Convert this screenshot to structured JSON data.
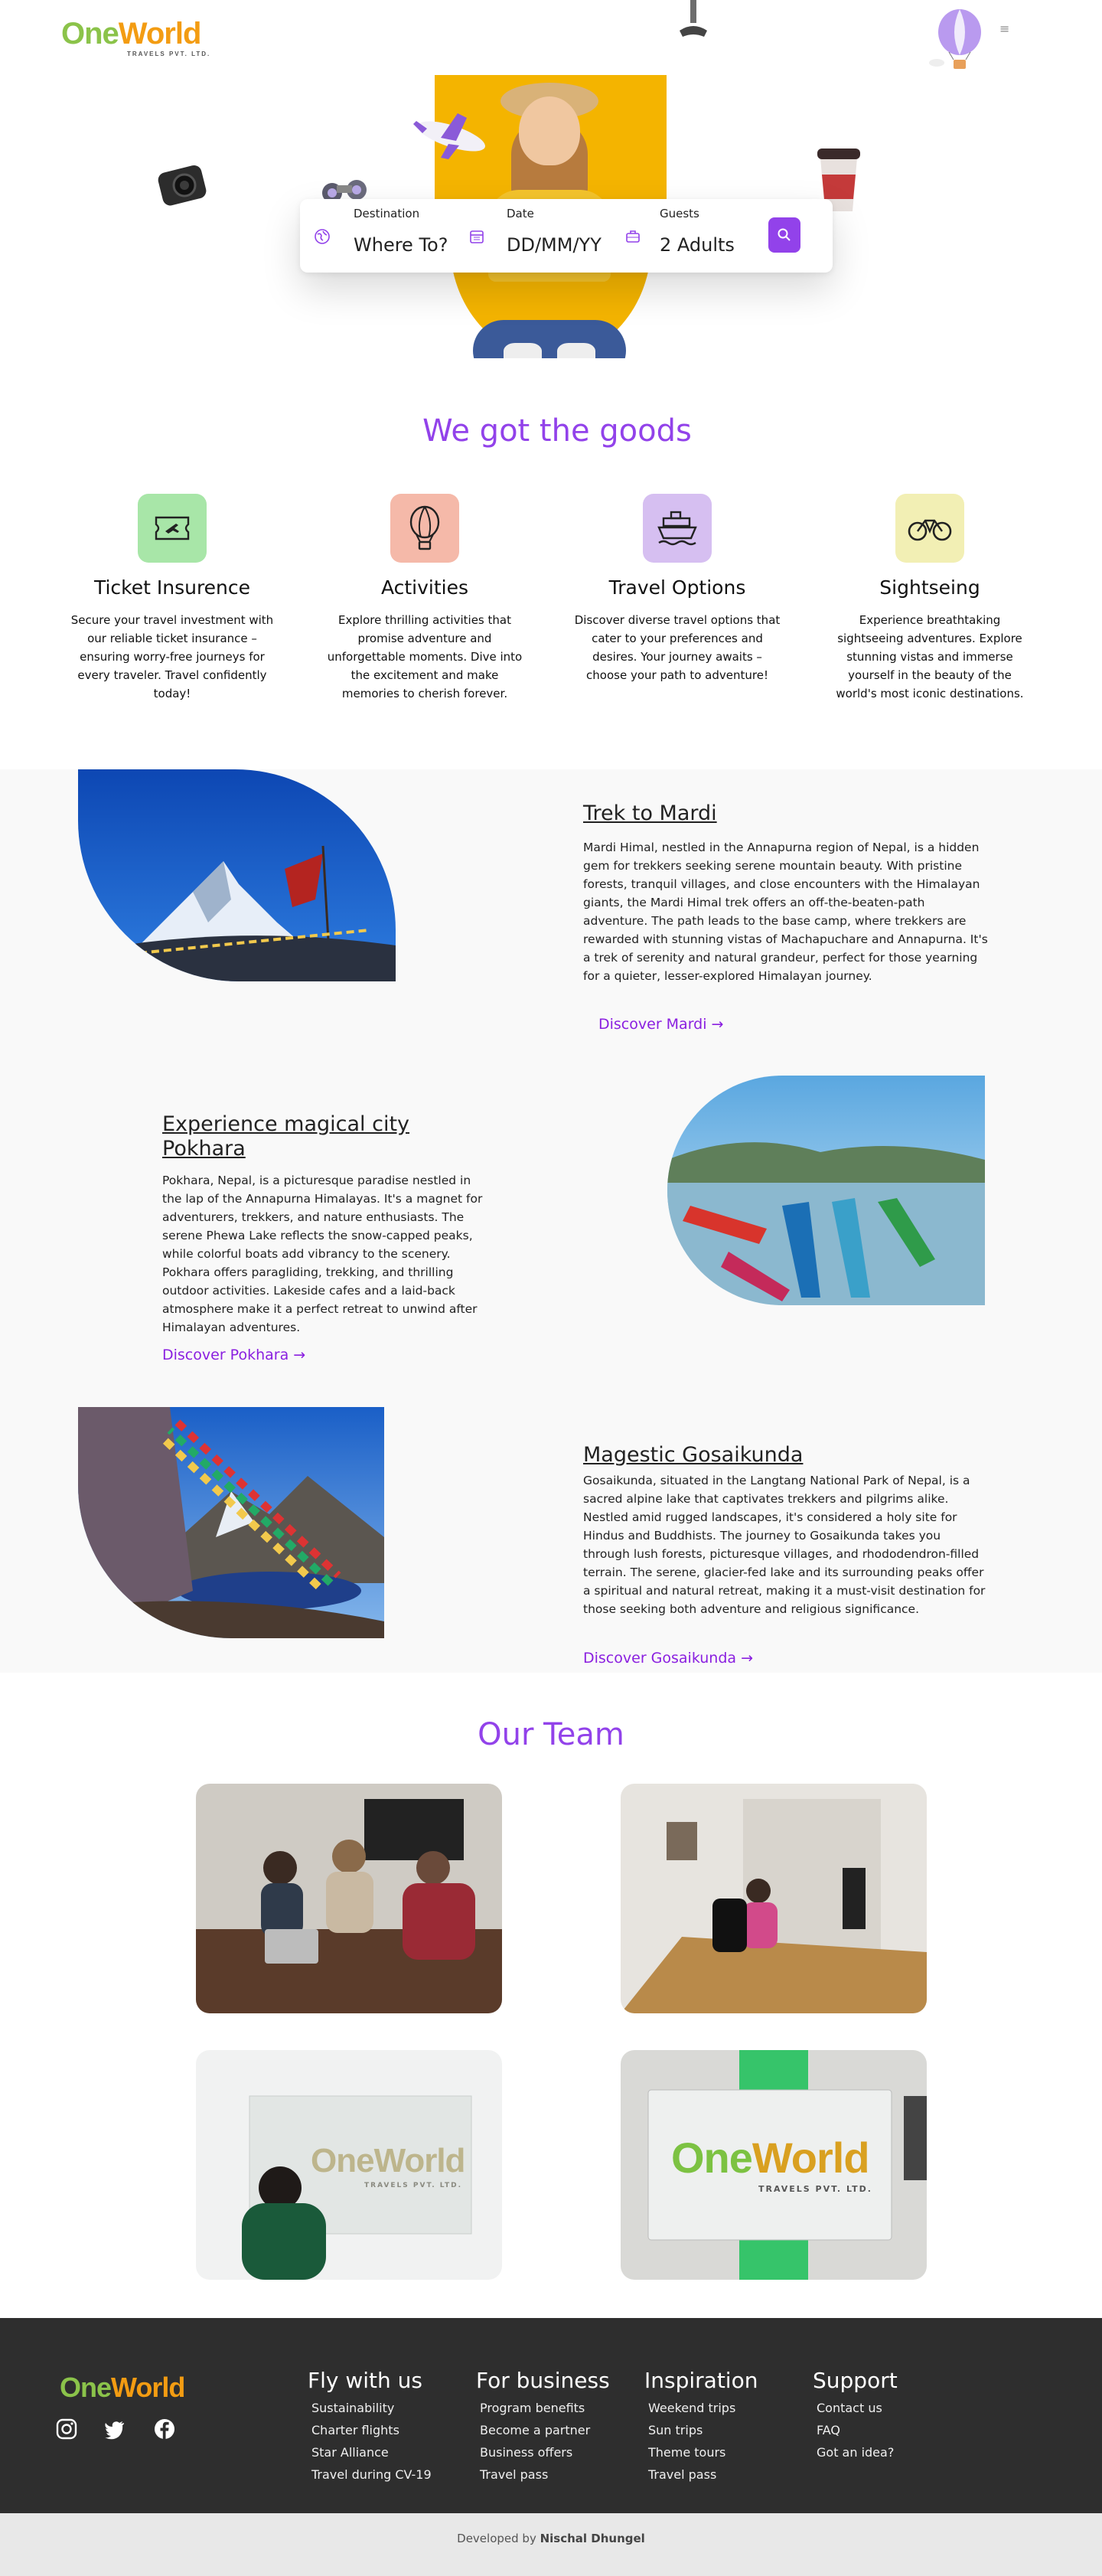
{
  "brand": {
    "name_part1": "One",
    "name_part2": "World",
    "tagline": "TRAVELS PVT. LTD."
  },
  "header": {
    "menu_icon": "≡"
  },
  "search": {
    "destination": {
      "label": "Destination",
      "value": "Where To?"
    },
    "date": {
      "label": "Date",
      "value": "DD/MM/YY"
    },
    "guests": {
      "label": "Guests",
      "value": "2 Adults"
    },
    "accent_color": "#9242ea"
  },
  "goods": {
    "title": "We got the goods",
    "items": [
      {
        "title": "Ticket Insurence",
        "icon": "ticket-icon",
        "bg": "#a8e6a8",
        "description": "Secure your travel investment with our reliable ticket insurance – ensuring worry-free journeys for every traveler. Travel confidently today!"
      },
      {
        "title": "Activities",
        "icon": "hot-air-balloon-icon",
        "bg": "#f5b9a9",
        "description": "Explore thrilling activities that promise adventure and unforgettable moments. Dive into the excitement and make memories to cherish forever."
      },
      {
        "title": "Travel Options",
        "icon": "ship-icon",
        "bg": "#d6bff1",
        "description": "Discover diverse travel options that cater to your preferences and desires. Your journey awaits – choose your path to adventure!"
      },
      {
        "title": "Sightseing",
        "icon": "bicycle-icon",
        "bg": "#f2efb4",
        "description": "Experience breathtaking sightseeing adventures. Explore stunning vistas and immerse yourself in the beauty of the world's most iconic destinations."
      }
    ]
  },
  "destinations": [
    {
      "title": "Trek to Mardi",
      "description": "Mardi Himal, nestled in the Annapurna region of Nepal, is a hidden gem for trekkers seeking serene mountain beauty. With pristine forests, tranquil villages, and close encounters with the Himalayan giants, the Mardi Himal trek offers an off-the-beaten-path adventure. The path leads to the base camp, where trekkers are rewarded with stunning vistas of Machapuchare and Annapurna. It's a trek of serenity and natural grandeur, perfect for those yearning for a quieter, lesser-explored Himalayan journey.",
      "link": "Discover Mardi →"
    },
    {
      "title": "Experience magical city Pokhara",
      "description": "Pokhara, Nepal, is a picturesque paradise nestled in the lap of the Annapurna Himalayas. It's a magnet for adventurers, trekkers, and nature enthusiasts. The serene Phewa Lake reflects the snow-capped peaks, while colorful boats add vibrancy to the scenery. Pokhara offers paragliding, trekking, and thrilling outdoor activities. Lakeside cafes and a laid-back atmosphere make it a perfect retreat to unwind after Himalayan adventures.",
      "link": "Discover Pokhara →"
    },
    {
      "title": "Magestic Gosaikunda",
      "description": "Gosaikunda, situated in the Langtang National Park of Nepal, is a sacred alpine lake that captivates trekkers and pilgrims alike. Nestled amid rugged landscapes, it's considered a holy site for Hindus and Buddhists. The journey to Gosaikunda takes you through lush forests, picturesque villages, and rhododendron-filled terrain. The serene, glacier-fed lake and its surrounding peaks offer a spiritual and natural retreat, making it a must-visit destination for those seeking both adventure and religious significance.",
      "link": "Discover Gosaikunda →"
    }
  ],
  "team": {
    "title": "Our Team",
    "sign_brand_part1": "One",
    "sign_brand_part2": "World",
    "sign_tagline": "TRAVELS PVT. LTD."
  },
  "footer": {
    "social_icons": [
      "instagram-icon",
      "twitter-icon",
      "facebook-icon"
    ],
    "columns": [
      {
        "title": "Fly with us",
        "items": [
          "Sustainability",
          "Charter flights",
          "Star Alliance",
          "Travel during CV-19"
        ]
      },
      {
        "title": "For business",
        "items": [
          "Program benefits",
          "Become a partner",
          "Business offers",
          "Travel pass"
        ]
      },
      {
        "title": "Inspiration",
        "items": [
          "Weekend trips",
          "Sun trips",
          "Theme tours",
          "Travel pass"
        ]
      },
      {
        "title": "Support",
        "items": [
          "Contact us",
          "FAQ",
          "Got an idea?"
        ]
      }
    ],
    "credit_prefix": "Developed by",
    "credit_name": "Nischal Dhungel"
  }
}
